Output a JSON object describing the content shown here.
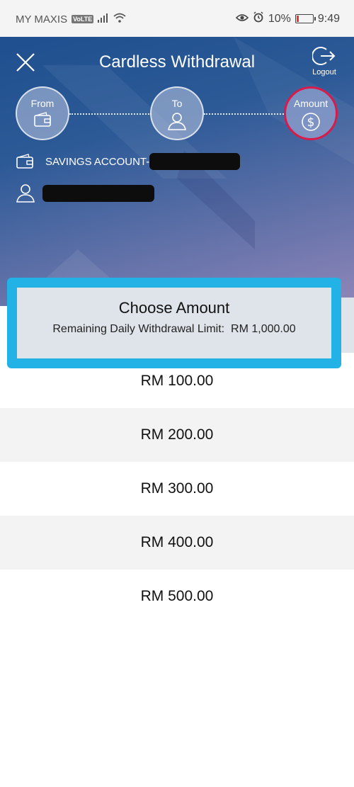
{
  "status_bar": {
    "carrier": "MY MAXIS",
    "network_badge": "VoLTE",
    "battery": "10%",
    "time": "9:49"
  },
  "header": {
    "title": "Cardless Withdrawal",
    "logout_label": "Logout"
  },
  "steps": [
    {
      "label": "From",
      "icon": "wallet-icon"
    },
    {
      "label": "To",
      "icon": "person-icon"
    },
    {
      "label": "Amount",
      "icon": "dollar-icon",
      "active": true
    }
  ],
  "account": {
    "from_label": "SAVINGS ACCOUNT-"
  },
  "amount_header": {
    "title": "Choose Amount",
    "limit_label": "Remaining Daily Withdrawal Limit:",
    "limit_value": "RM 1,000.00"
  },
  "amounts": [
    "RM 100.00",
    "RM 200.00",
    "RM 300.00",
    "RM 400.00",
    "RM 500.00"
  ],
  "colors": {
    "highlight_border": "#22b2e6",
    "active_step_border": "#d81b4a",
    "banner_top": "#1f4f8e"
  }
}
